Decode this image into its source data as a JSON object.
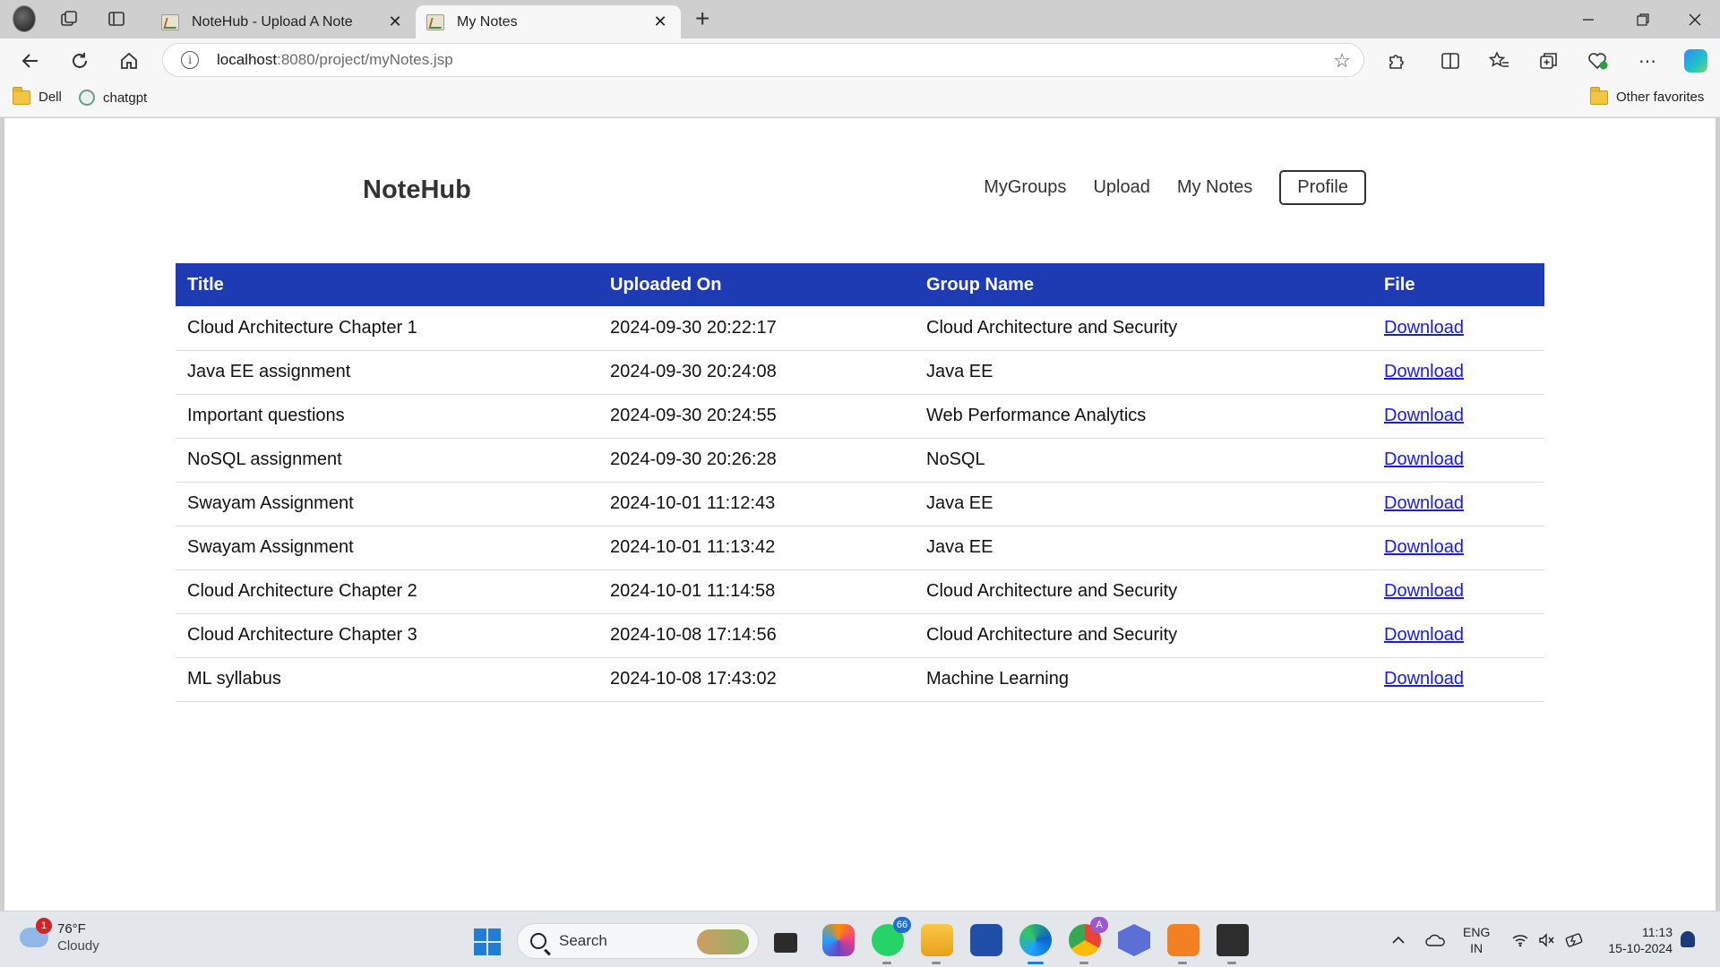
{
  "browser": {
    "tabs": [
      {
        "title": "NoteHub - Upload A Note",
        "active": false
      },
      {
        "title": "My Notes",
        "active": true
      }
    ],
    "new_tab_label": "+",
    "url": {
      "host": "localhost",
      "rest": ":8080/project/myNotes.jsp"
    },
    "favorites": [
      {
        "label": "Dell",
        "icon": "folder-icon"
      },
      {
        "label": "chatgpt",
        "icon": "chatgpt-icon"
      }
    ],
    "other_favorites": "Other favorites"
  },
  "site": {
    "brand": "NoteHub",
    "nav": {
      "my_groups": "MyGroups",
      "upload": "Upload",
      "my_notes": "My Notes",
      "profile": "Profile"
    }
  },
  "table": {
    "headers": [
      "Title",
      "Uploaded On",
      "Group Name",
      "File"
    ],
    "rows": [
      {
        "title": "Cloud Architecture Chapter 1",
        "uploaded_on": "2024-09-30 20:22:17",
        "group": "Cloud Architecture and Security",
        "file": "Download"
      },
      {
        "title": "Java EE assignment",
        "uploaded_on": "2024-09-30 20:24:08",
        "group": "Java EE",
        "file": "Download"
      },
      {
        "title": "Important questions",
        "uploaded_on": "2024-09-30 20:24:55",
        "group": "Web Performance Analytics",
        "file": "Download"
      },
      {
        "title": "NoSQL assignment",
        "uploaded_on": "2024-09-30 20:26:28",
        "group": "NoSQL",
        "file": "Download"
      },
      {
        "title": "Swayam Assignment",
        "uploaded_on": "2024-10-01 11:12:43",
        "group": "Java EE",
        "file": "Download"
      },
      {
        "title": "Swayam Assignment",
        "uploaded_on": "2024-10-01 11:13:42",
        "group": "Java EE",
        "file": "Download"
      },
      {
        "title": "Cloud Architecture Chapter 2",
        "uploaded_on": "2024-10-01 11:14:58",
        "group": "Cloud Architecture and Security",
        "file": "Download"
      },
      {
        "title": "Cloud Architecture Chapter 3",
        "uploaded_on": "2024-10-08 17:14:56",
        "group": "Cloud Architecture and Security",
        "file": "Download"
      },
      {
        "title": "ML syllabus",
        "uploaded_on": "2024-10-08 17:43:02",
        "group": "Machine Learning",
        "file": "Download"
      }
    ]
  },
  "taskbar": {
    "weather": {
      "temp": "76°F",
      "condition": "Cloudy",
      "badge": "1"
    },
    "search_placeholder": "Search",
    "whatsapp_badge": "66",
    "chrome_badge": "A",
    "language": {
      "line1": "ENG",
      "line2": "IN"
    },
    "clock": {
      "time": "11:13",
      "date": "15-10-2024"
    }
  },
  "colors": {
    "table_header_bg": "#1f3bb3",
    "link": "#1a1ae6"
  }
}
